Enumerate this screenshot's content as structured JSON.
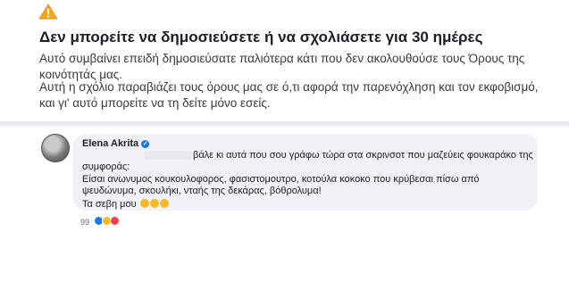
{
  "notice": {
    "icon": "warning-icon",
    "title": "Δεν μπορείτε να δημοσιεύσετε ή να σχολιάσετε για 30 ημέρες",
    "paragraph1": "Αυτό συμβαίνει επειδή δημοσιεύσατε παλιότερα κάτι που δεν ακολουθούσε τους Όρους της κοινότητάς μας.",
    "paragraph2": "Αυτή η σχόλιο παραβιάζει τους όρους μας σε ό,τι αφορά την παρενόχληση και τον εκφοβισμό, και γι' αυτό μπορείτε να τη δείτε μόνο εσείς."
  },
  "comment": {
    "author": "Elena Akrita",
    "verified_icon": "verified-badge-icon",
    "lines": [
      "βάλε κι αυτά που σου γράφω τώρα στα σκρινσοτ που μαζεύεις φουκαράκο της",
      "συμφοράς:",
      "Είσαι ανωνυμος κουκουλοφορος, φασιστομουτρο, κοτούλα κοκοκο που κρύβεσαι πίσω από",
      "ψευδώνυμα, σκουλήκι, νταής της δεκάρας, βόθρολυμα!",
      "Τα σεβη μου"
    ],
    "emoji_icons": [
      "laughing-emoji-icon",
      "laughing-emoji-icon",
      "laughing-emoji-icon"
    ],
    "reaction_count": "99",
    "reaction_icons": [
      "like-reaction-icon",
      "haha-reaction-icon",
      "love-reaction-icon"
    ]
  },
  "colors": {
    "warning": "#f5a623",
    "bubble": "#f0f2f5",
    "verified": "#1877f2"
  }
}
